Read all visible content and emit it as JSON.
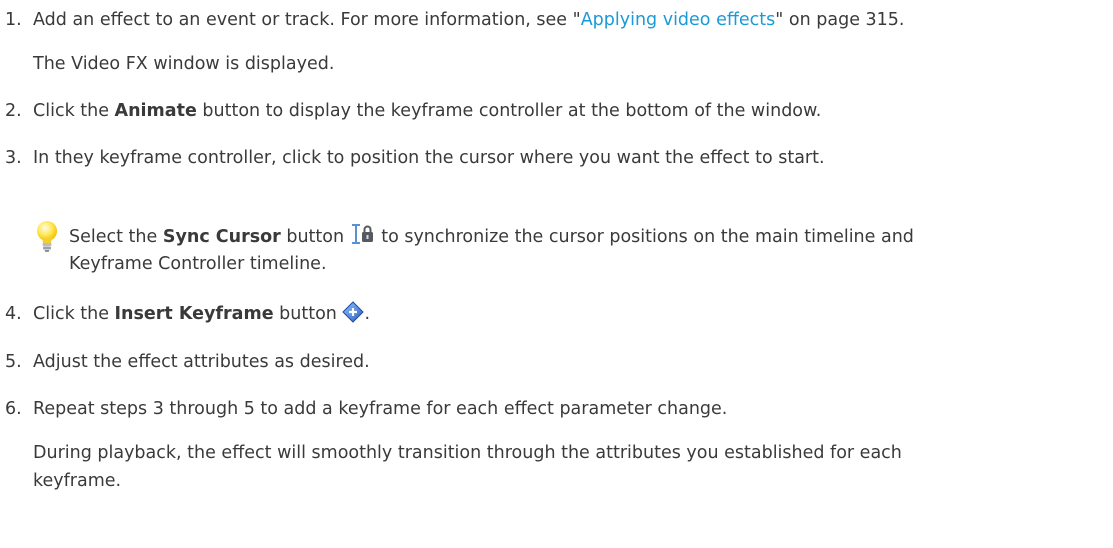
{
  "steps": [
    {
      "num": "1.",
      "text_pre": "Add an effect to an event or track. For more information, see \"",
      "link": "Applying video effects",
      "text_post": "\" on page 315.",
      "note": "The Video FX window is displayed."
    },
    {
      "num": "2.",
      "text_pre": "Click the ",
      "bold": "Animate",
      "text_post": " button to display the keyframe controller at the bottom of the window."
    },
    {
      "num": "3.",
      "text": "In they keyframe controller, click to position the cursor where you want the effect to start."
    },
    {
      "num": "4.",
      "text_pre": "Click the ",
      "bold": "Insert Keyframe",
      "text_post": " button",
      "text_end": "."
    },
    {
      "num": "5.",
      "text": "Adjust the effect attributes as desired."
    },
    {
      "num": "6.",
      "text": "Repeat steps 3 through 5 to add a keyframe for each effect parameter change.",
      "note_line1": "During playback, the effect will smoothly transition through the attributes you established for each",
      "note_line2": "keyframe."
    }
  ],
  "tip": {
    "icon": "lightbulb-icon",
    "text_pre": "Select the ",
    "bold": "Sync Cursor",
    "text_mid": " button ",
    "text_post": " to synchronize the cursor positions on the main timeline and",
    "line2": "Keyframe Controller timeline."
  },
  "icons": {
    "sync_cursor": "sync-cursor-icon",
    "insert_keyframe": "insert-keyframe-icon"
  },
  "colors": {
    "link": "#1a9ad6",
    "text": "#3a3a3a"
  }
}
